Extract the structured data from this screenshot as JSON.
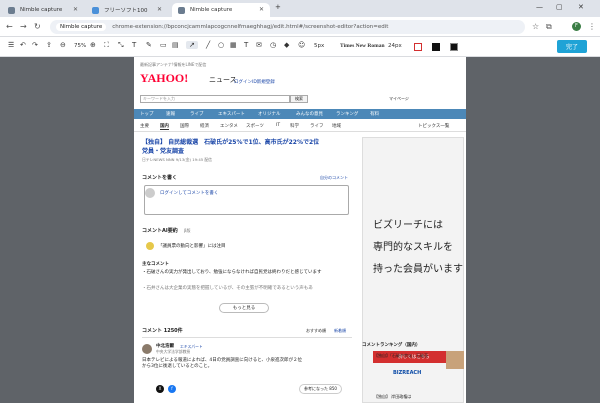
{
  "browser": {
    "tabs": [
      {
        "title": "Nimble capture",
        "active": false
      },
      {
        "title": "フリーソフト100",
        "active": false
      },
      {
        "title": "Nimble capture",
        "active": true
      }
    ],
    "chip": "Nimble capture",
    "url": "chrome-extension://bpconcjcammlapcogcnnelfmaeghhagj/edit.html#/screenshot-editor?action=edit",
    "avatar": "F"
  },
  "editor": {
    "zoom": "75%",
    "stroke": "5px",
    "font": "Times New Roman",
    "font_size": "24px",
    "done": "完了"
  },
  "page": {
    "topline": "最新記事アンテナ!情報をLINEで配信",
    "logo": "YAHOO!",
    "logo_sub": "ニュース",
    "promo1": "ログイン",
    "promo2": "ID新規登録",
    "search_placeholder": "キーワードを入力",
    "search_btn": "検索",
    "my_settings": "マイページ",
    "menu": [
      "トップ",
      "速報",
      "ライブ",
      "エキスパート",
      "オリジナル",
      "みんなの意見",
      "ランキング",
      "有料"
    ],
    "submenu": [
      "主要",
      "国内",
      "国際",
      "経済",
      "エンタメ",
      "スポーツ",
      "IT",
      "科学",
      "ライフ",
      "地域"
    ],
    "topics": "トピックス一覧",
    "headline1": "【独自】 自民総裁選　石破氏が25%で1位、高市氏が22%で2位",
    "headline2": "党員・党友調査",
    "byline": "日テレNEWS NNN  9/13(金) 19:45 配信",
    "comment_title": "コメントを書く",
    "comment_link": "自分のコメント",
    "comment_ph": "ログインしてコメントを書く",
    "ai_title": "コメントAI要約",
    "ai_badge": "β版",
    "ai_person": "「議員票の動向と影響」には注目",
    "main_title": "主なコメント",
    "bullet1": "・石破さんの実力が発出しており、勉強にならなければ自民党は終わりだと感じています",
    "bullet2": "・石井さんは大企業の実態を把握しているが、その主張が不明確であるという声もあ",
    "more_btn": "もっと見る",
    "count_title": "コメント 1250件",
    "sort1": "おすすめ順",
    "sort2": "新着順",
    "author": "中北浩爾",
    "author_role": "中央大学法学部教授",
    "author_badge": "エキスパート",
    "author_body1": "日本テレビによる報道によれば、4日の党員調査に向けると、小泉進次郎が２位",
    "author_body2": "から3位に後退しているとのこと。",
    "likes": "参考になった 850",
    "ad_line1": "ビズリーチには",
    "ad_line2": "専門的なスキルを",
    "ad_line3": "持った会員がいます",
    "ad_btn": "詳しくはこちら",
    "ad_brand": "BIZREACH",
    "ranking": "コメントランキング（国内）",
    "rank1": "【独自】「石破や宗派」石破茂",
    "rank2": "【独自】 岸田政権は"
  },
  "colors": {
    "accent": "#1fa3d6",
    "menu": "#4c88b8",
    "headline": "#1a46a8",
    "ad_red": "#d32f2f"
  }
}
